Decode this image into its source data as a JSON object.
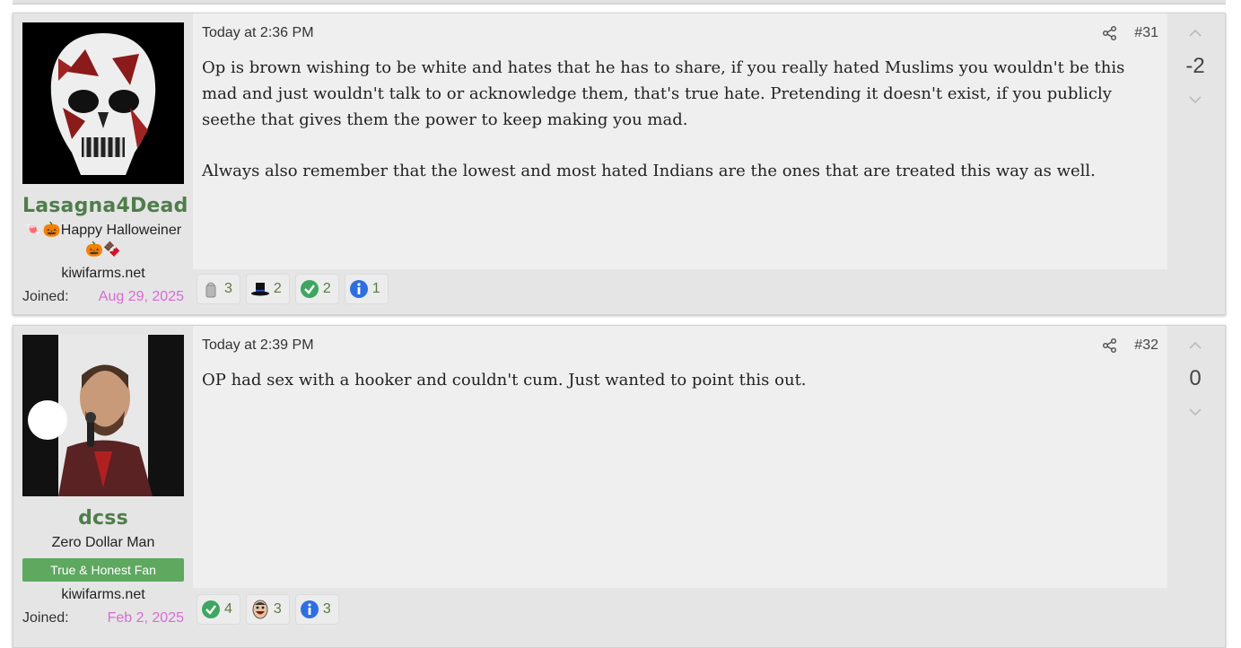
{
  "posts": [
    {
      "username": "Lasagna4Dead",
      "user_title": "🍬🎃Happy Halloweiner 🎃🍫",
      "site": "kiwifarms.net",
      "joined_label": "Joined:",
      "joined_date": "Aug 29, 2025",
      "date": "Today at 2:36 PM",
      "post_number": "#31",
      "score": "-2",
      "paragraphs": [
        "Op is brown wishing to be white and hates that he has to share, if you really hated Muslims you wouldn't be this mad and just wouldn't talk to or acknowledge them, that's true hate. Pretending it doesn't exist, if you publicly seethe that gives them the power to keep making you mad.",
        "Always also remember that the lowest and most hated Indians are the ones that are treated this way as well."
      ],
      "reactions": [
        {
          "icon": "salt-shaker-icon",
          "count": "3"
        },
        {
          "icon": "top-hat-icon",
          "count": "2"
        },
        {
          "icon": "checkmark-icon",
          "count": "2"
        },
        {
          "icon": "info-icon",
          "count": "1"
        }
      ]
    },
    {
      "username": "dcss",
      "user_title": "Zero Dollar Man",
      "banner": "True & Honest Fan",
      "site": "kiwifarms.net",
      "joined_label": "Joined:",
      "joined_date": "Feb 2, 2025",
      "date": "Today at 2:39 PM",
      "post_number": "#32",
      "score": "0",
      "paragraphs": [
        "OP had sex with a hooker and couldn't cum. Just wanted to point this out."
      ],
      "reactions": [
        {
          "icon": "checkmark-icon",
          "count": "4"
        },
        {
          "icon": "laughing-face-icon",
          "count": "3"
        },
        {
          "icon": "info-icon",
          "count": "3"
        }
      ]
    }
  ],
  "colors": {
    "username": "#4f7d4b",
    "joined_date": "#d96bd6",
    "banner_bg": "#5ea85f",
    "reaction_count": "#5a7a3e"
  }
}
